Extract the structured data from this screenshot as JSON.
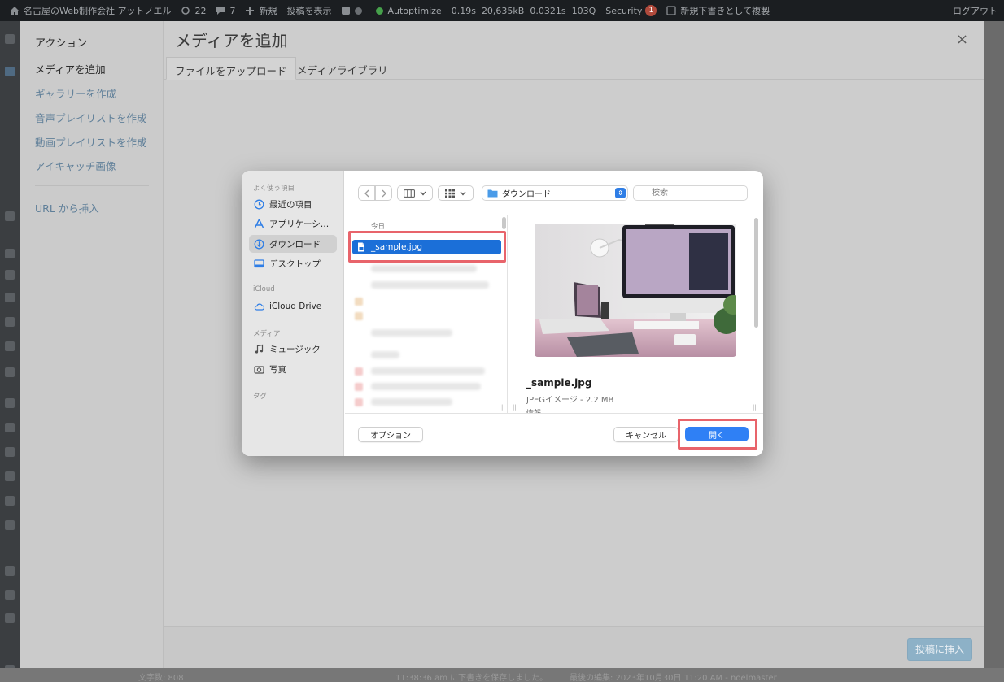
{
  "adminbar": {
    "site_name": "名古屋のWeb制作会社 アットノエル",
    "updates_count": "22",
    "comments_count": "7",
    "new_label": "新規",
    "view_post_label": "投稿を表示",
    "autoptimize_label": "Autoptimize",
    "stat_time": "0.19s",
    "stat_memory": "20,635kB",
    "stat_query_time": "0.0321s",
    "stat_queries": "103Q",
    "security_label": "Security",
    "security_badge": "1",
    "duplicate_draft_label": "新規下書きとして複製",
    "logout_label": "ログアウト"
  },
  "modal": {
    "title": "メディアを追加",
    "close_icon": "×",
    "menu_heading": "アクション",
    "menu_items": [
      {
        "label": "メディアを追加",
        "active": true
      },
      {
        "label": "ギャラリーを作成",
        "active": false
      },
      {
        "label": "音声プレイリストを作成",
        "active": false
      },
      {
        "label": "動画プレイリストを作成",
        "active": false
      },
      {
        "label": "アイキャッチ画像",
        "active": false
      }
    ],
    "url_insert_label": "URL から挿入",
    "tabs": [
      {
        "label": "ファイルをアップロード",
        "active": true
      },
      {
        "label": "メディアライブラリ",
        "active": false
      }
    ],
    "insert_button": "投稿に挿入"
  },
  "footer_status": {
    "word_count": "文字数: 808",
    "saved_status": "11:38:36 am に下書きを保存しました。",
    "last_edited": "最後の編集: 2023年10月30日 11:20 AM - noelmaster"
  },
  "dialog": {
    "sidebar": {
      "favorites_heading": "よく使う項目",
      "favorites": [
        {
          "label": "最近の項目",
          "icon": "clock-icon",
          "selected": false
        },
        {
          "label": "アプリケーシ…",
          "icon": "apps-icon",
          "selected": false
        },
        {
          "label": "ダウンロード",
          "icon": "download-icon",
          "selected": true
        },
        {
          "label": "デスクトップ",
          "icon": "desktop-icon",
          "selected": false
        }
      ],
      "icloud_heading": "iCloud",
      "icloud": [
        {
          "label": "iCloud Drive",
          "icon": "cloud-icon"
        }
      ],
      "media_heading": "メディア",
      "media": [
        {
          "label": "ミュージック",
          "icon": "music-icon"
        },
        {
          "label": "写真",
          "icon": "camera-icon"
        }
      ],
      "tags_heading": "タグ"
    },
    "toolbar": {
      "location": "ダウンロード",
      "search_placeholder": "検索"
    },
    "file_list": {
      "section_label": "今日",
      "selected_file": "_sample.jpg"
    },
    "preview": {
      "filename": "_sample.jpg",
      "meta": "JPEGイメージ - 2.2 MB",
      "info_label": "情報"
    },
    "buttons": {
      "options": "オプション",
      "cancel": "キャンセル",
      "open": "開く"
    }
  },
  "colors": {
    "accent_blue": "#1b6fd8",
    "open_button": "#2f80f5",
    "highlight_red": "#e8646b",
    "admin_bar": "#1b1e21"
  }
}
